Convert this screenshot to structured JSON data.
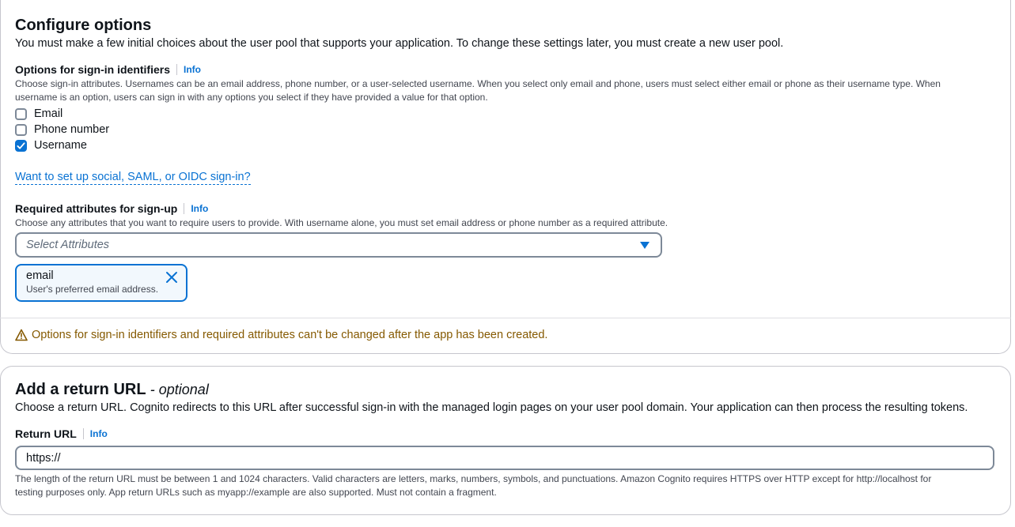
{
  "configure": {
    "title": "Configure options",
    "description": "You must make a few initial choices about the user pool that supports your application. To change these settings later, you must create a new user pool.",
    "signin": {
      "label": "Options for sign-in identifiers",
      "info": "Info",
      "help_line1": "Choose sign-in attributes. Usernames can be an email address, phone number, or a user-selected username. When you select only email and phone, users must select either email or phone as their username type. When",
      "help_line2": "username is an option, users can sign in with any options you select if they have provided a value for that option.",
      "options": [
        {
          "label": "Email",
          "checked": false
        },
        {
          "label": "Phone number",
          "checked": false
        },
        {
          "label": "Username",
          "checked": true
        }
      ]
    },
    "social_link": "Want to set up social, SAML, or OIDC sign-in?",
    "required": {
      "label": "Required attributes for sign-up",
      "info": "Info",
      "help": "Choose any attributes that you want to require users to provide. With username alone, you must set email address or phone number as a required attribute.",
      "select_placeholder": "Select Attributes",
      "token_name": "email",
      "token_desc": "User's preferred email address."
    },
    "warning": "Options for sign-in identifiers and required attributes can't be changed after the app has been created."
  },
  "return_url": {
    "title": "Add a return URL",
    "title_suffix": "- optional",
    "description": "Choose a return URL. Cognito redirects to this URL after successful sign-in with the managed login pages on your user pool domain. Your application can then process the resulting tokens.",
    "label": "Return URL",
    "info": "Info",
    "value": "https://",
    "help_line1": "The length of the return URL must be between 1 and 1024 characters. Valid characters are letters, marks, numbers, symbols, and punctuations. Amazon Cognito requires HTTPS over HTTP except for http://localhost for",
    "help_line2": "testing purposes only. App return URLs such as myapp://example are also supported. Must not contain a fragment."
  },
  "colors": {
    "accent": "#0972d3",
    "warning": "#855900",
    "border": "#7d8998"
  }
}
